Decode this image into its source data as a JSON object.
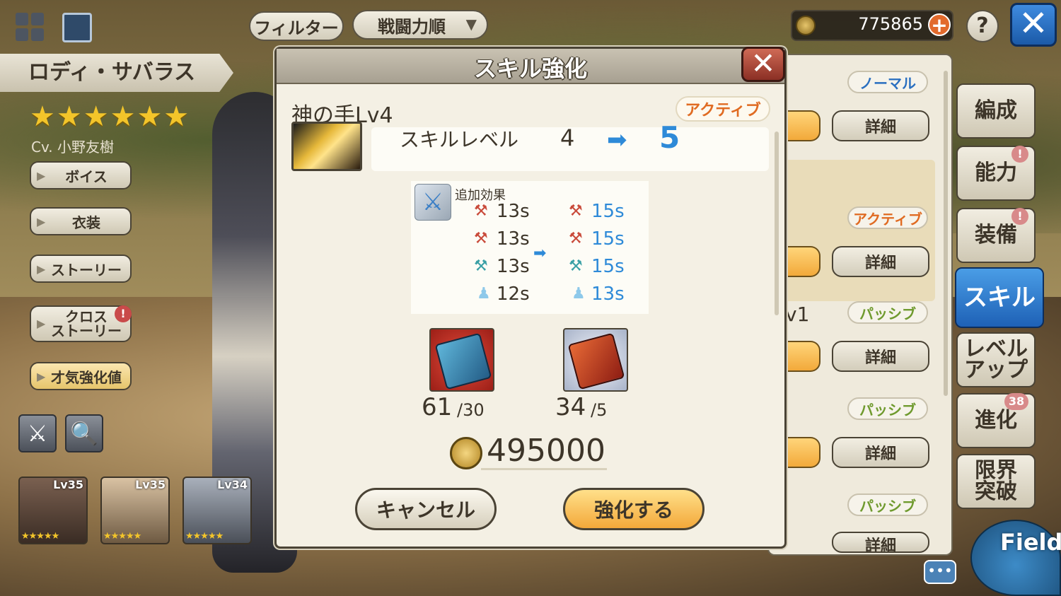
{
  "topbar": {
    "filter_label": "フィルター",
    "sort_label": "戦闘力順",
    "coins": "775865",
    "help_label": "?",
    "close_label": "✕"
  },
  "character": {
    "name": "ロディ・サバラス",
    "stars": "★★★★★★",
    "star_count": 6,
    "cv": "Cv. 小野友樹"
  },
  "left_menu": {
    "voice": "ボイス",
    "costume": "衣装",
    "story": "ストーリー",
    "cross_story": "クロス\nストーリー",
    "talent": "才気強化値"
  },
  "roster": [
    {
      "level": "Lv35",
      "stars": "★★★★★"
    },
    {
      "level": "Lv35",
      "stars": "★★★★★"
    },
    {
      "level": "Lv34",
      "stars": "★★★★★"
    }
  ],
  "right_panel": {
    "tags": [
      "ノーマル",
      "アクティブ",
      "パッシブ",
      "パッシブ",
      "パッシブ"
    ],
    "detail_label": "詳細",
    "partial_text": "v1"
  },
  "right_menu": {
    "formation": "編成",
    "ability": "能力",
    "equipment": "装備",
    "skill": "スキル",
    "levelup": "レベル\nアップ",
    "evolution": "進化",
    "limit_break": "限界\n突破",
    "badge_evolution": "38",
    "field": "Field",
    "chat": "•••"
  },
  "dialog": {
    "title": "スキル強化",
    "close_label": "✕",
    "skill_name": "神の手Lv4",
    "skill_type": "アクティブ",
    "level_label": "スキルレベル",
    "level_from": "4",
    "level_to": "5",
    "effects_title": "追加効果",
    "effects": [
      {
        "icon": "red-axe-icon",
        "from": "13s",
        "to": "15s"
      },
      {
        "icon": "red-axe-icon",
        "from": "13s",
        "to": "15s"
      },
      {
        "icon": "blue-axe-icon",
        "from": "13s",
        "to": "15s"
      },
      {
        "icon": "ghost-icon",
        "from": "12s",
        "to": "13s"
      }
    ],
    "materials": [
      {
        "name": "blue-book",
        "have": "61",
        "need": "/30"
      },
      {
        "name": "red-book",
        "have": "34",
        "need": "/5"
      }
    ],
    "cost": "495000",
    "cancel_label": "キャンセル",
    "confirm_label": "強化する"
  },
  "colors": {
    "accent_blue": "#2e8ad8",
    "active_orange": "#e06b22",
    "passive_green": "#6f9a2e",
    "normal_blue": "#2a6fc0"
  }
}
